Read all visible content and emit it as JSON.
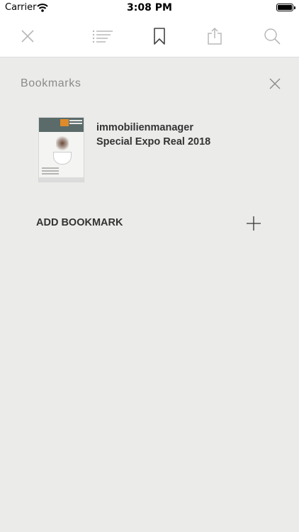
{
  "status_bar": {
    "carrier": "Carrier",
    "time": "3:08 PM"
  },
  "toolbar": {
    "icons": [
      "close-icon",
      "toc-icon",
      "bookmark-icon",
      "share-icon",
      "search-icon"
    ],
    "active_icon": "bookmark-icon"
  },
  "panel": {
    "title": "Bookmarks",
    "bookmarks": [
      {
        "title_line1": "immobilienmanager",
        "title_line2": "Special Expo Real 2018"
      }
    ],
    "add_label": "ADD BOOKMARK"
  },
  "colors": {
    "panel_bg": "#ebebea",
    "toolbar_icon_inactive": "#b8b8b8",
    "toolbar_icon_active": "#444444",
    "text_dark": "#333333",
    "text_muted": "#8a8a8a"
  }
}
